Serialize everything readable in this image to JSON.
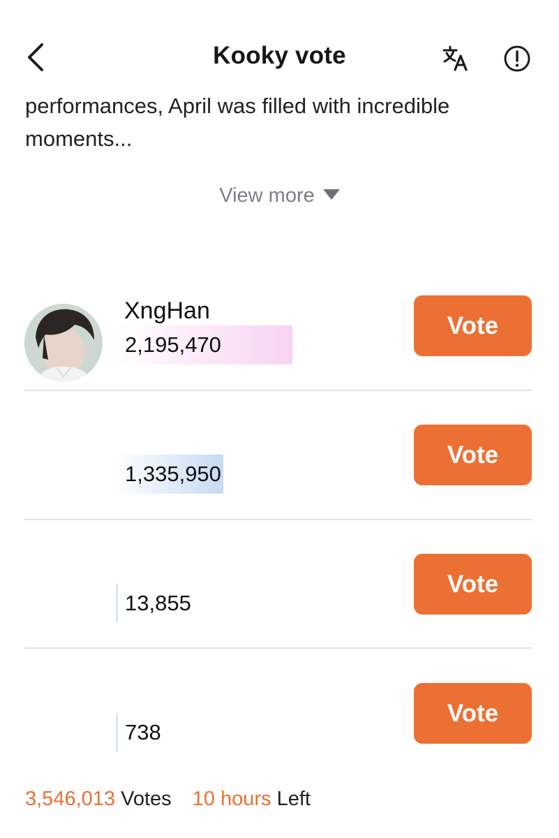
{
  "header": {
    "title": "Kooky vote",
    "back_icon": "chevron-left-icon",
    "translate_icon": "translate-icon",
    "report_icon": "exclamation-circle-icon"
  },
  "description": {
    "text": "performances, April was filled with incredible\nmoments..."
  },
  "view_more": {
    "label": "View more",
    "icon": "caret-down-icon"
  },
  "candidates": [
    {
      "name": "XngHan",
      "votes": "2,195,470",
      "vote_label": "Vote",
      "bar_share": 0.619,
      "bar_color": "#f7d3f1"
    },
    {
      "name": "",
      "votes": "1,335,950",
      "vote_label": "Vote",
      "bar_share": 0.377,
      "bar_color": "#c6daf3"
    },
    {
      "name": "",
      "votes": "13,855",
      "vote_label": "Vote",
      "bar_share": 0.004,
      "bar_color": "#c6daf3"
    },
    {
      "name": "",
      "votes": "738",
      "vote_label": "Vote",
      "bar_share": 0.0002,
      "bar_color": "#c6daf3"
    }
  ],
  "footer": {
    "total_votes": "3,546,013",
    "votes_label": "Votes",
    "time_left": "10 hours",
    "left_label": "Left"
  },
  "colors": {
    "accent": "#ec7033",
    "divider": "#e2e2e2",
    "muted_text": "#7b7f86"
  }
}
